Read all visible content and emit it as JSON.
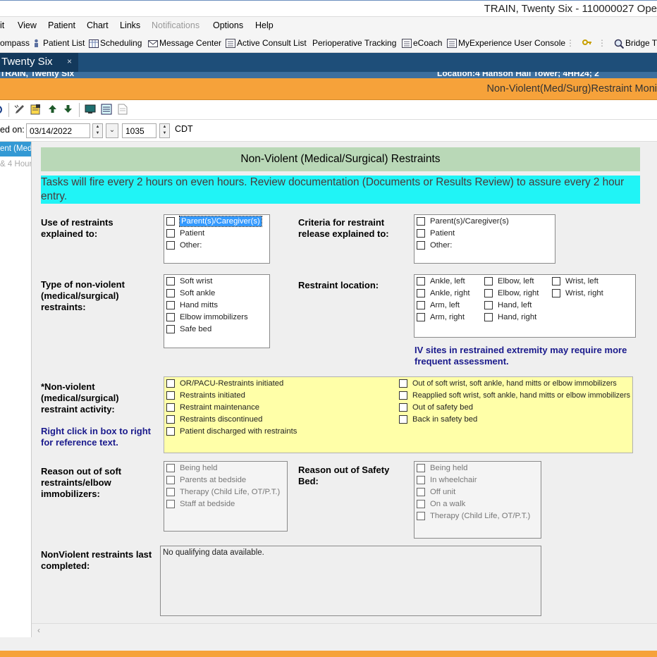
{
  "window": {
    "title": "TRAIN, Twenty Six - 110000027 Ope"
  },
  "menu": {
    "items": [
      "it",
      "View",
      "Patient",
      "Chart",
      "Links",
      "Notifications",
      "Options",
      "Help"
    ]
  },
  "toolbar": {
    "items": [
      "ompass",
      "Patient List",
      "Scheduling",
      "Message Center",
      "Active Consult List",
      "Perioperative Tracking",
      "eCoach",
      "MyExperience User Console",
      "Bridge T"
    ]
  },
  "tab": {
    "label": "Twenty Six",
    "close": "×"
  },
  "banner": {
    "name": "TRAIN, Twenty Six",
    "location": "Location:4 Hanson Hall Tower; 4HH24; 2"
  },
  "form_title": "Non-Violent(Med/Surg)Restraint Moni",
  "date_bar": {
    "label": "ed on:",
    "date": "03/14/2022",
    "time": "1035",
    "tz": "CDT"
  },
  "left_nav": {
    "selected": "ent (Med",
    "sub": "& 4 Hours"
  },
  "section_header": "Non-Violent (Medical/Surgical) Restraints",
  "alert_text": "Tasks will fire every 2 hours on even hours. Review documentation (Documents or Results Review) to assure every 2 hour entry.",
  "use_explained": {
    "label": "Use of restraints explained to:",
    "options": [
      "Parent(s)/Caregiver(s)",
      "Patient",
      "Other:"
    ]
  },
  "criteria_release": {
    "label": "Criteria for restraint release explained to:",
    "options": [
      "Parent(s)/Caregiver(s)",
      "Patient",
      "Other:"
    ]
  },
  "type_restraints": {
    "label": "Type of non-violent (medical/surgical) restraints:",
    "options": [
      "Soft wrist",
      "Soft ankle",
      "Hand mitts",
      "Elbow immobilizers",
      "Safe bed"
    ]
  },
  "location": {
    "label": "Restraint location:",
    "col1": [
      "Ankle, left",
      "Ankle, right",
      "Arm, left",
      "Arm, right"
    ],
    "col2": [
      "Elbow, left",
      "Elbow, right",
      "Hand, left",
      "Hand, right"
    ],
    "col3": [
      "Wrist, left",
      "Wrist, right"
    ],
    "note": "IV sites in restrained extremity may require more frequent assessment."
  },
  "activity": {
    "label": "*Non-violent (medical/surgical) restraint activity:",
    "note": "Right click in box to right for reference text.",
    "col1": [
      "OR/PACU-Restraints initiated",
      "Restraints initiated",
      "Restraint maintenance",
      "Restraints discontinued",
      "Patient discharged with restraints"
    ],
    "col2": [
      "Out of soft wrist, soft ankle, hand mitts or elbow immobilizers",
      "Reapplied soft wrist, soft ankle, hand mitts or elbow immobilizers",
      "Out of safety bed",
      "Back in safety bed"
    ]
  },
  "reason_soft": {
    "label": "Reason out of soft restraints/elbow immobilizers:",
    "options": [
      "Being held",
      "Parents at bedside",
      "Therapy (Child Life, OT/P.T.)",
      "Staff at bedside"
    ]
  },
  "reason_safety": {
    "label": "Reason out of Safety Bed:",
    "options": [
      "Being held",
      "In wheelchair",
      "Off unit",
      "On a walk",
      "Therapy (Child Life, OT/P.T.)"
    ]
  },
  "last_completed": {
    "label": "NonViolent restraints last completed:",
    "value": "No qualifying data available."
  },
  "colors": {
    "accent_orange": "#f6a23a",
    "header_green": "#b9d8b7",
    "alert_cyan": "#20f4f6",
    "activity_yellow": "#ffffa8",
    "tab_blue": "#1e4e79"
  }
}
